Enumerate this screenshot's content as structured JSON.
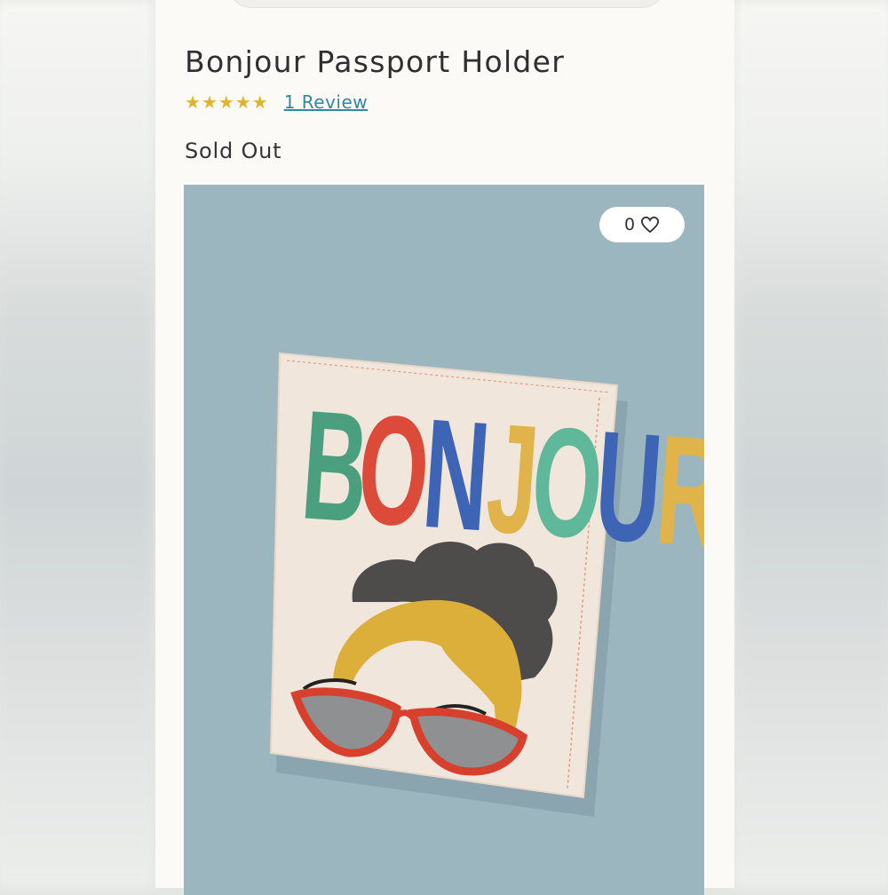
{
  "product": {
    "title": "Bonjour Passport Holder",
    "rating": 5,
    "reviews_link": "1 Review",
    "status": "Sold Out",
    "likes": "0",
    "cover_lettering": "BONJOUR!"
  },
  "colors": {
    "star": "#e0b42c",
    "link": "#35869f",
    "image_background": "#9cb6c0",
    "panel": "#fbfaf6"
  },
  "icons": {
    "star": "star-icon",
    "like": "heart-icon"
  }
}
